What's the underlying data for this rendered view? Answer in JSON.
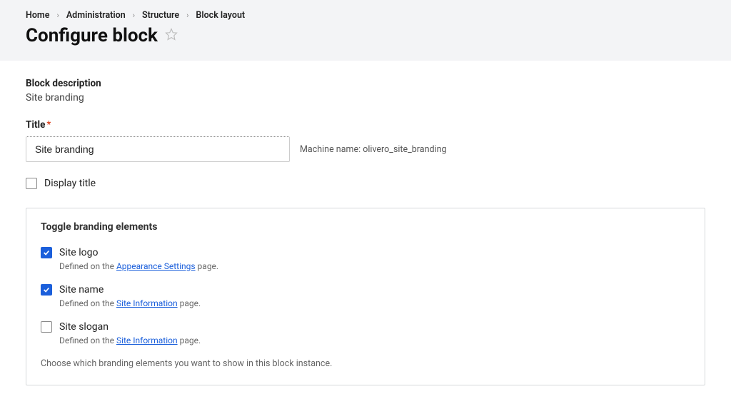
{
  "breadcrumb": {
    "items": [
      "Home",
      "Administration",
      "Structure",
      "Block layout"
    ]
  },
  "page": {
    "title": "Configure block"
  },
  "block_description": {
    "label": "Block description",
    "value": "Site branding"
  },
  "title_field": {
    "label": "Title",
    "value": "Site branding",
    "machine_name_label": "Machine name:",
    "machine_name_value": "olivero_site_branding"
  },
  "display_title": {
    "label": "Display title"
  },
  "toggle": {
    "title": "Toggle branding elements",
    "options": [
      {
        "label": "Site logo",
        "checked": true,
        "desc_prefix": "Defined on the ",
        "desc_link": "Appearance Settings",
        "desc_suffix": " page."
      },
      {
        "label": "Site name",
        "checked": true,
        "desc_prefix": "Defined on the ",
        "desc_link": "Site Information",
        "desc_suffix": " page."
      },
      {
        "label": "Site slogan",
        "checked": false,
        "desc_prefix": "Defined on the ",
        "desc_link": "Site Information",
        "desc_suffix": " page."
      }
    ],
    "help": "Choose which branding elements you want to show in this block instance."
  }
}
